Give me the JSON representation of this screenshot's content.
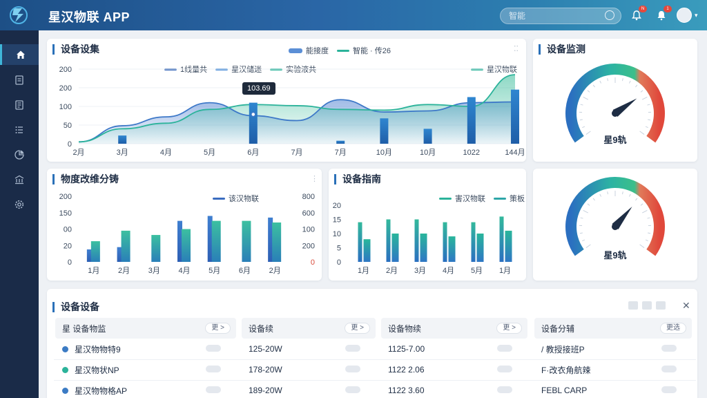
{
  "header": {
    "app_title": "星汉物联 APP",
    "search_placeholder": "智能",
    "badge_1": "N",
    "badge_2": "1"
  },
  "sidebar": {
    "items": [
      "home-icon",
      "document-icon",
      "list-icon",
      "menu-icon",
      "chart-pie-icon",
      "building-icon",
      "gear-icon"
    ]
  },
  "cards": {
    "main_chart": {
      "title": "设备设集",
      "top_legend": [
        "能接度",
        "智能 · 传26"
      ],
      "tooltip": "103.69"
    },
    "gauge_top": {
      "title": "设备监测",
      "label": "星9轨"
    },
    "bar_left": {
      "title": "物度改维分铸"
    },
    "bar_mid": {
      "title": "设备指南"
    },
    "gauge_bottom": {
      "label": "星9轨"
    },
    "table": {
      "title": "设备设备"
    }
  },
  "table": {
    "columns": [
      {
        "label": "星  设备物监",
        "pill": "更 >"
      },
      {
        "label": "设备续",
        "pill": "更 >"
      },
      {
        "label": "设备物续",
        "pill": "更 >"
      },
      {
        "label": "设备分辅",
        "pill": "更选"
      }
    ],
    "rows": [
      {
        "dot": "#3b7bc4",
        "c1": "星汉物物特9",
        "c2": "125-20W",
        "c3": "1125-7.00",
        "c4": "/ 教授接班P"
      },
      {
        "dot": "#2bb39a",
        "c1": "星汉物状NP",
        "c2": "178-20W",
        "c3": "1122 2.06",
        "c4": "F·改衣角航辣"
      },
      {
        "dot": "#3b7bc4",
        "c1": "星汉物物格AP",
        "c2": "189-20W",
        "c3": "1122 3.60",
        "c4": "FEBL CARP"
      }
    ]
  },
  "chart_data": [
    {
      "type": "line",
      "categories": [
        "2月",
        "3月",
        "4月",
        "5月",
        "6月",
        "7月",
        "7月",
        "10月",
        "10月",
        "1022",
        "144月"
      ],
      "y_ticks": [
        "200",
        "200",
        "100",
        "50",
        "0"
      ],
      "ylim": [
        0,
        200
      ],
      "legend": [
        "1线量共",
        "星汉储迷",
        "实验液共",
        "星汉物联"
      ],
      "series": [
        {
          "name": "1线量共",
          "values": [
            5,
            48,
            72,
            110,
            75,
            62,
            118,
            85,
            88,
            110,
            112
          ]
        },
        {
          "name": "实验液共",
          "values": [
            5,
            40,
            55,
            92,
            105,
            102,
            92,
            90,
            105,
            100,
            185
          ]
        }
      ],
      "bars": [
        0,
        22,
        0,
        0,
        110,
        0,
        8,
        68,
        40,
        125,
        145
      ]
    },
    {
      "type": "bar",
      "categories": [
        "1月",
        "2月",
        "3月",
        "4月",
        "5月",
        "6月",
        "2月"
      ],
      "y_ticks": [
        "200",
        "150",
        "00",
        "20",
        "0"
      ],
      "y2_ticks": [
        "800",
        "600",
        "100",
        "200",
        "0"
      ],
      "ylim": [
        0,
        200
      ],
      "legend": [
        "该汉物联"
      ],
      "series": [
        {
          "name": "该汉物联",
          "values": [
            [
              38,
              63
            ],
            [
              45,
              95
            ],
            [
              0,
              82
            ],
            [
              125,
              100
            ],
            [
              140,
              125
            ],
            [
              0,
              125
            ],
            [
              135,
              120
            ]
          ]
        }
      ]
    },
    {
      "type": "bar",
      "categories": [
        "1月",
        "2月",
        "3月",
        "4月",
        "5月",
        "1月"
      ],
      "y_ticks": [
        "20",
        "15",
        "10",
        "5",
        "0"
      ],
      "ylim": [
        0,
        20
      ],
      "legend": [
        "害汉物联",
        "策板"
      ],
      "series": [
        {
          "name": "害汉物联",
          "values": [
            14,
            15,
            15,
            14,
            14,
            16
          ]
        },
        {
          "name": "策板",
          "values": [
            8,
            10,
            10,
            9,
            10,
            11
          ]
        }
      ]
    },
    {
      "type": "gauge",
      "value": 0.72
    },
    {
      "type": "gauge",
      "value": 0.66
    }
  ]
}
